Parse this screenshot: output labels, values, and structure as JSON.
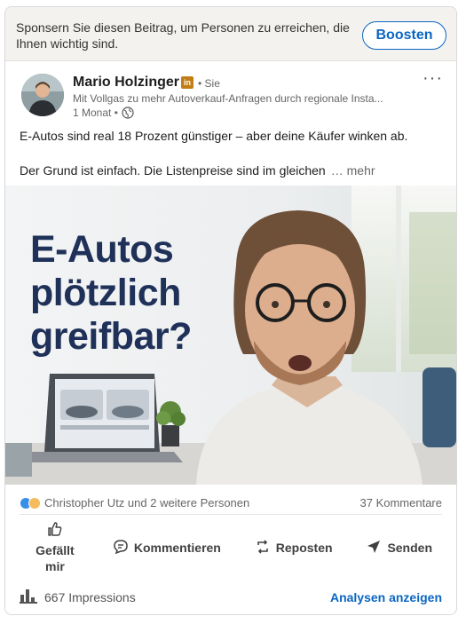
{
  "promo": {
    "text": "Sponsern Sie diesen Beitrag, um Personen zu erreichen, die Ihnen wichtig sind.",
    "button_label": "Boosten"
  },
  "author": {
    "name": "Mario Holzinger",
    "badge": "in",
    "degree": "• Sie",
    "headline": "Mit Vollgas zu mehr Autoverkauf-Anfragen durch regionale Insta...",
    "time": "1 Monat •",
    "more_label": "···"
  },
  "post": {
    "line1": "E-Autos sind real 18 Prozent günstiger – aber deine Käufer winken ab.",
    "line2": "Der Grund ist einfach. Die Listenpreise sind im gleichen",
    "see_more": "… mehr"
  },
  "image": {
    "headline_lines": [
      "E-Autos",
      "plötzlich",
      "greifbar?"
    ]
  },
  "social": {
    "reactions_text": "Christopher Utz und 2 weitere Personen",
    "comments_text": "37 Kommentare"
  },
  "actions": {
    "like": "Gefällt mir",
    "comment": "Kommentieren",
    "repost": "Reposten",
    "send": "Senden"
  },
  "footer": {
    "impressions": "667 Impressions",
    "analytics": "Analysen anzeigen"
  },
  "colors": {
    "brand_blue": "#0a66c2",
    "headline_navy": "#1f3159",
    "premium_gold": "#c37d16"
  }
}
